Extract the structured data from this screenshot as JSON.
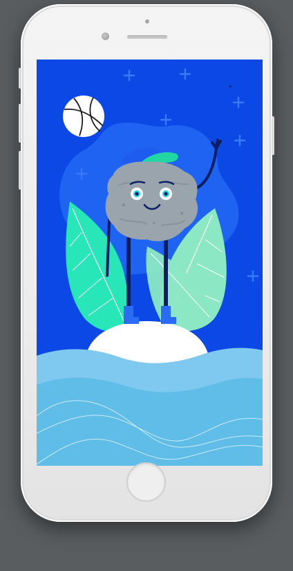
{
  "device": {
    "model_type": "smartphone",
    "color": "white",
    "page_background": "#595d60"
  },
  "screen": {
    "background": "#0b48e6",
    "content_type": "illustration",
    "palette": {
      "sky": "#0b48e6",
      "blob": "#1e63f2",
      "plus_marks": "#3b78ff",
      "moon": "#ffffff",
      "leaf_green": "#28e6b8",
      "leaf_light": "#8ce8c4",
      "rock": "#9aa4ad",
      "cap": "#22d6a4",
      "boots": "#2a6cf5",
      "legs": "#0a1f63",
      "hill": "#ffffff",
      "water_top": "#7fc8f0",
      "water_bottom": "#5fbde8"
    }
  },
  "illustration": {
    "character": "rock",
    "character_pose": "waving",
    "icons": [
      "moon-icon",
      "plus-icon",
      "cap-icon",
      "leaf-icon",
      "wave-icon"
    ]
  }
}
